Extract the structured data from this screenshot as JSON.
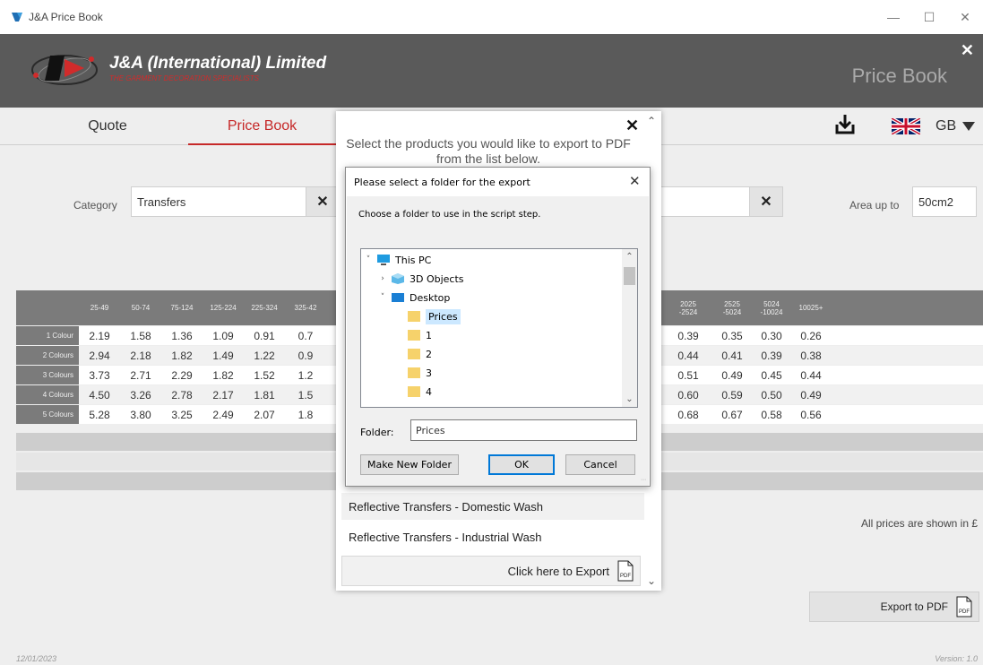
{
  "window": {
    "title": "J&A Price Book",
    "controls": [
      "—",
      "☐",
      "✕"
    ]
  },
  "header": {
    "company_name": "J&A (International) Limited",
    "tagline": "THE GARMENT DECORATION SPECIALISTS",
    "section_title": "Price Book",
    "close": "✕"
  },
  "nav": {
    "tabs": [
      {
        "label": "Quote"
      },
      {
        "label": "Price Book",
        "active": true
      }
    ],
    "language": "GB"
  },
  "filters": {
    "category_label": "Category",
    "category_value": "Transfers",
    "clear": "✕",
    "area_label": "Area up to",
    "area_value": "50cm2"
  },
  "table": {
    "headers_left": [
      "25-49",
      "50-74",
      "75-124",
      "125-224",
      "225-324",
      "325-42"
    ],
    "headers_right": [
      "2025\n-2524",
      "2525\n-5024",
      "5024\n-10024",
      "10025+"
    ],
    "rows": [
      {
        "label": "1 Colour",
        "left": [
          "2.19",
          "1.58",
          "1.36",
          "1.09",
          "0.91",
          "0.7"
        ],
        "right": [
          "0.39",
          "0.35",
          "0.30",
          "0.26"
        ]
      },
      {
        "label": "2 Colours",
        "left": [
          "2.94",
          "2.18",
          "1.82",
          "1.49",
          "1.22",
          "0.9"
        ],
        "right": [
          "0.44",
          "0.41",
          "0.39",
          "0.38"
        ]
      },
      {
        "label": "3 Colours",
        "left": [
          "3.73",
          "2.71",
          "2.29",
          "1.82",
          "1.52",
          "1.2"
        ],
        "right": [
          "0.51",
          "0.49",
          "0.45",
          "0.44"
        ]
      },
      {
        "label": "4 Colours",
        "left": [
          "4.50",
          "3.26",
          "2.78",
          "2.17",
          "1.81",
          "1.5"
        ],
        "right": [
          "0.60",
          "0.59",
          "0.50",
          "0.49"
        ]
      },
      {
        "label": "5 Colours",
        "left": [
          "5.28",
          "3.80",
          "3.25",
          "2.49",
          "2.07",
          "1.8"
        ],
        "right": [
          "0.68",
          "0.67",
          "0.58",
          "0.56"
        ]
      }
    ]
  },
  "prices_note": "All prices are shown in £",
  "export_button": "Export to PDF",
  "pdf_icon_text": "PDF",
  "footer": {
    "date": "12/01/2023",
    "version": "Version: 1.0"
  },
  "export_panel": {
    "close": "✕",
    "instructions": "Select the products you would like to export to PDF from the list below.",
    "items": [
      "Reflective Transfers - Domestic Wash",
      "Reflective Transfers - Industrial Wash"
    ],
    "export_label": "Click here to Export"
  },
  "folder_dialog": {
    "title": "Please select a folder for the export",
    "close": "✕",
    "prompt": "Choose a folder to use in the script step.",
    "tree": [
      {
        "label": "This PC",
        "expander": "˅",
        "icon": "pc-icon"
      },
      {
        "label": "3D Objects",
        "expander": "›",
        "icon": "3d-objects-icon"
      },
      {
        "label": "Desktop",
        "expander": "˅",
        "icon": "desktop-icon"
      },
      {
        "label": "Prices",
        "expander": "",
        "icon": "folder-icon",
        "selected": true
      },
      {
        "label": "1",
        "expander": "",
        "icon": "folder-icon"
      },
      {
        "label": "2",
        "expander": "",
        "icon": "folder-icon"
      },
      {
        "label": "3",
        "expander": "",
        "icon": "folder-icon"
      },
      {
        "label": "4",
        "expander": "",
        "icon": "folder-icon"
      }
    ],
    "folder_label": "Folder:",
    "folder_value": "Prices",
    "buttons": {
      "new_folder": "Make New Folder",
      "ok": "OK",
      "cancel": "Cancel"
    }
  },
  "colors": {
    "accent_red": "#c62828",
    "header_bg": "#5a5a5a",
    "table_header_bg": "#7b7b7b",
    "selection": "#cce8ff"
  }
}
